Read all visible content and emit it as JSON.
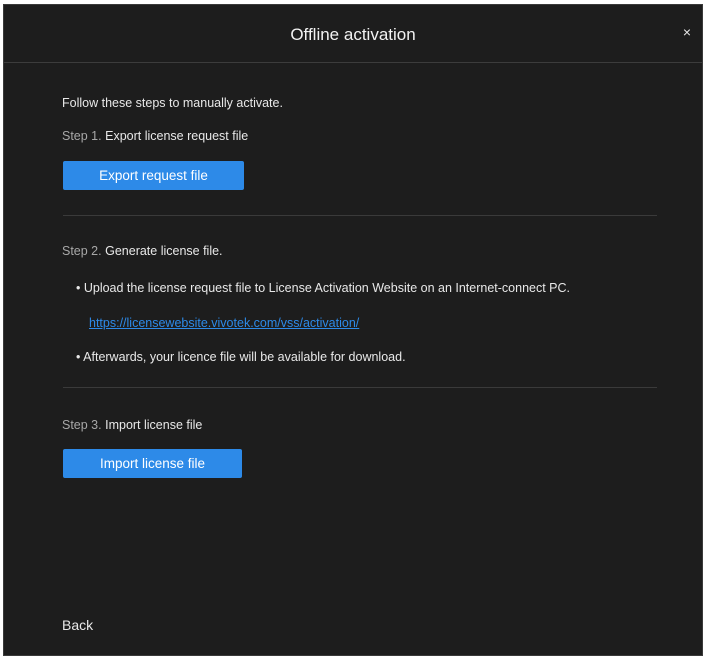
{
  "dialog": {
    "title": "Offline activation",
    "close_glyph": "×"
  },
  "intro": "Follow these steps to manually activate.",
  "step1": {
    "prefix": "Step 1.",
    "label": "Export license request file",
    "button": "Export request file"
  },
  "step2": {
    "prefix": "Step 2.",
    "label": "Generate license file.",
    "bullet1": "• Upload the license request file to License Activation Website on an Internet-connect PC.",
    "link": "https://licensewebsite.vivotek.com/vss/activation/",
    "bullet2": "• Afterwards, your licence file will be available for download."
  },
  "step3": {
    "prefix": "Step 3.",
    "label": "Import license file",
    "button": "Import license file"
  },
  "footer": {
    "back": "Back"
  },
  "colors": {
    "background": "#1d1d1d",
    "accent": "#2d8ae8",
    "text": "#e8e8e8",
    "muted": "#a8a8a8"
  },
  "icons": {
    "close": "close-icon"
  }
}
